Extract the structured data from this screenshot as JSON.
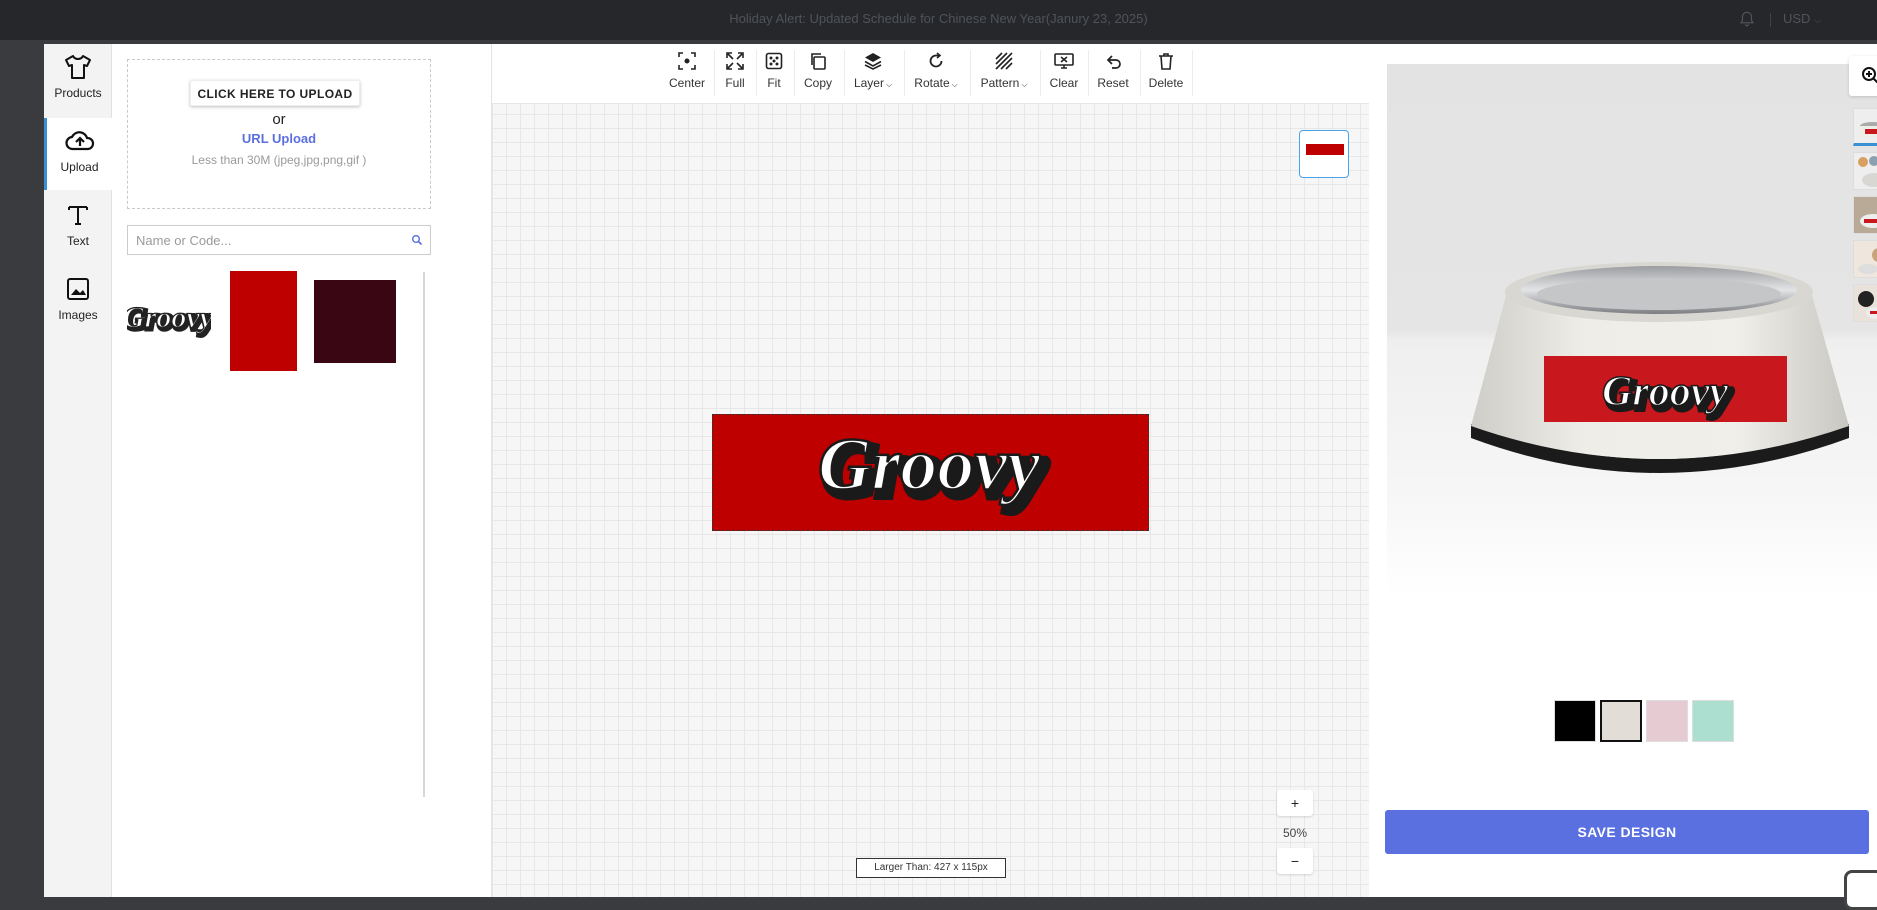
{
  "topbar": {
    "alert": "Holiday Alert: Updated Schedule for Chinese New Year(Janury 23, 2025)",
    "currency": "USD"
  },
  "nav": {
    "items": [
      {
        "label": "Products",
        "icon": "tshirt-icon"
      },
      {
        "label": "Upload",
        "icon": "cloud-upload-icon"
      },
      {
        "label": "Text",
        "icon": "text-icon"
      },
      {
        "label": "Images",
        "icon": "image-icon"
      }
    ],
    "active": "Upload"
  },
  "upload": {
    "button": "CLICK HERE TO UPLOAD",
    "or": "or",
    "url": "URL Upload",
    "hint": "Less than 30M (jpeg,jpg,png,gif )"
  },
  "search": {
    "placeholder": "Name or Code..."
  },
  "uploads": [
    {
      "kind": "logo",
      "text": "Groovy"
    },
    {
      "kind": "swatch",
      "color": "#bf0000"
    },
    {
      "kind": "swatch",
      "color": "#3a0613"
    }
  ],
  "toolbar": {
    "tools": [
      {
        "label": "Center",
        "icon": "center-icon"
      },
      {
        "label": "Full",
        "icon": "fullscreen-icon"
      },
      {
        "label": "Fit",
        "icon": "fit-icon"
      },
      {
        "label": "Copy",
        "icon": "copy-icon"
      },
      {
        "label": "Layer",
        "icon": "layers-icon",
        "dropdown": true
      },
      {
        "label": "Rotate",
        "icon": "rotate-icon",
        "dropdown": true
      },
      {
        "label": "Pattern",
        "icon": "pattern-icon",
        "dropdown": true
      },
      {
        "label": "Clear",
        "icon": "clear-icon"
      },
      {
        "label": "Reset",
        "icon": "undo-icon"
      },
      {
        "label": "Delete",
        "icon": "trash-icon"
      }
    ]
  },
  "canvas": {
    "design_text": "Groovy",
    "design_bg": "#bf0000",
    "zoom_in": "+",
    "zoom_out": "−",
    "zoom_level": "50%",
    "size_note": "Larger Than: 427 x 115px"
  },
  "preview": {
    "label_text": "Groovy",
    "colors": [
      "#000000",
      "#e2ddd6",
      "#e7cbd3",
      "#acdfcf"
    ],
    "selected_color": "#e2ddd6",
    "save": "SAVE DESIGN"
  },
  "accent": "#5a6fe0"
}
